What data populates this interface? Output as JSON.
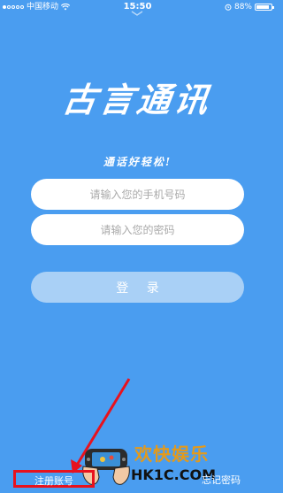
{
  "status_bar": {
    "carrier": "中国移动",
    "time": "15:50",
    "battery": "88%",
    "battery_level": 0.88
  },
  "app": {
    "logo": "古言通讯",
    "slogan": "通话好轻松!"
  },
  "form": {
    "phone_placeholder": "请输入您的手机号码",
    "phone_value": "",
    "password_placeholder": "请输入您的密码",
    "password_value": "",
    "login_label": "登 录"
  },
  "footer": {
    "register_label": "注册账号",
    "forgot_label": "忘记密码"
  },
  "watermark": {
    "line1": "欢快娱乐",
    "line2": "HK1C.COM",
    "annotation_color": "#e8121e"
  },
  "colors": {
    "background": "#4a9df0",
    "login_button": "#a9d0f6"
  },
  "icons": [
    "signal-dots-icon",
    "wifi-icon",
    "alarm-icon",
    "battery-icon",
    "swipe-down-hint-icon",
    "gamepad-icon"
  ]
}
